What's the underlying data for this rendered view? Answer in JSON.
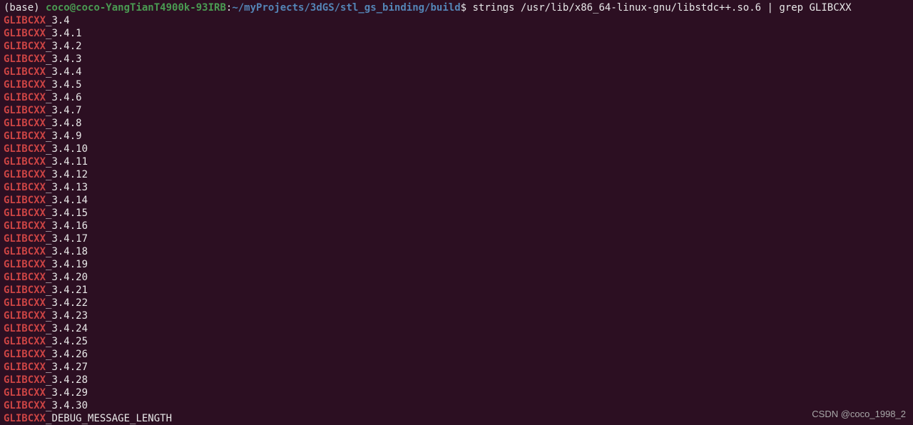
{
  "prompt": {
    "env_prefix": "(base) ",
    "user_host": "coco@coco-YangTianT4900k-93IRB",
    "colon": ":",
    "path": "~/myProjects/3dGS/stl_gs_binding/build",
    "dollar": "$ ",
    "command": "strings /usr/lib/x86_64-linux-gnu/libstdc++.so.6 | grep GLIBCXX"
  },
  "output_lines": [
    {
      "highlight": "GLIBCXX",
      "rest": "_3.4"
    },
    {
      "highlight": "GLIBCXX",
      "rest": "_3.4.1"
    },
    {
      "highlight": "GLIBCXX",
      "rest": "_3.4.2"
    },
    {
      "highlight": "GLIBCXX",
      "rest": "_3.4.3"
    },
    {
      "highlight": "GLIBCXX",
      "rest": "_3.4.4"
    },
    {
      "highlight": "GLIBCXX",
      "rest": "_3.4.5"
    },
    {
      "highlight": "GLIBCXX",
      "rest": "_3.4.6"
    },
    {
      "highlight": "GLIBCXX",
      "rest": "_3.4.7"
    },
    {
      "highlight": "GLIBCXX",
      "rest": "_3.4.8"
    },
    {
      "highlight": "GLIBCXX",
      "rest": "_3.4.9"
    },
    {
      "highlight": "GLIBCXX",
      "rest": "_3.4.10"
    },
    {
      "highlight": "GLIBCXX",
      "rest": "_3.4.11"
    },
    {
      "highlight": "GLIBCXX",
      "rest": "_3.4.12"
    },
    {
      "highlight": "GLIBCXX",
      "rest": "_3.4.13"
    },
    {
      "highlight": "GLIBCXX",
      "rest": "_3.4.14"
    },
    {
      "highlight": "GLIBCXX",
      "rest": "_3.4.15"
    },
    {
      "highlight": "GLIBCXX",
      "rest": "_3.4.16"
    },
    {
      "highlight": "GLIBCXX",
      "rest": "_3.4.17"
    },
    {
      "highlight": "GLIBCXX",
      "rest": "_3.4.18"
    },
    {
      "highlight": "GLIBCXX",
      "rest": "_3.4.19"
    },
    {
      "highlight": "GLIBCXX",
      "rest": "_3.4.20"
    },
    {
      "highlight": "GLIBCXX",
      "rest": "_3.4.21"
    },
    {
      "highlight": "GLIBCXX",
      "rest": "_3.4.22"
    },
    {
      "highlight": "GLIBCXX",
      "rest": "_3.4.23"
    },
    {
      "highlight": "GLIBCXX",
      "rest": "_3.4.24"
    },
    {
      "highlight": "GLIBCXX",
      "rest": "_3.4.25"
    },
    {
      "highlight": "GLIBCXX",
      "rest": "_3.4.26"
    },
    {
      "highlight": "GLIBCXX",
      "rest": "_3.4.27"
    },
    {
      "highlight": "GLIBCXX",
      "rest": "_3.4.28"
    },
    {
      "highlight": "GLIBCXX",
      "rest": "_3.4.29"
    },
    {
      "highlight": "GLIBCXX",
      "rest": "_3.4.30"
    },
    {
      "highlight": "GLIBCXX",
      "rest": "_DEBUG_MESSAGE_LENGTH"
    }
  ],
  "watermark": "CSDN @coco_1998_2"
}
